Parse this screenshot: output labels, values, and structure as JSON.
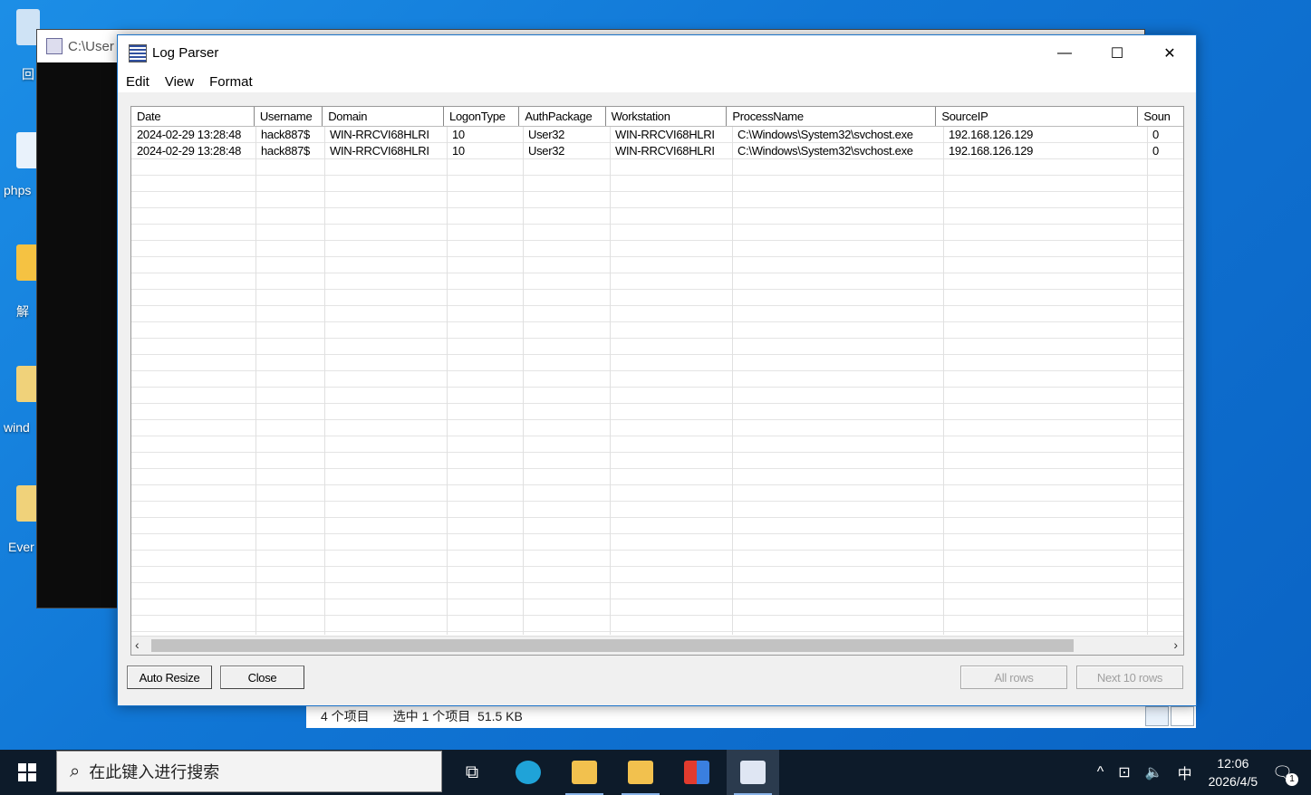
{
  "desktop": {
    "icons": [
      {
        "label": "回",
        "color": "#cfe3f5"
      },
      {
        "label": "phps",
        "color": "#e9f2fb"
      },
      {
        "label": "解",
        "color": "#f5c242"
      },
      {
        "label": "wind",
        "color": "#f0d27a"
      },
      {
        "label": "Ever",
        "color": "#f0d27a"
      }
    ]
  },
  "console": {
    "title": "C:\\User"
  },
  "explorer_status": {
    "items_count": "4 个项目",
    "selected": "选中 1 个项目  51.5 KB"
  },
  "window": {
    "title": "Log Parser",
    "controls": {
      "minimize": "—",
      "maximize": "☐",
      "close": "✕"
    },
    "menu": [
      "Edit",
      "View",
      "Format"
    ]
  },
  "grid": {
    "columns": [
      "Date",
      "Username",
      "Domain",
      "LogonType",
      "AuthPackage",
      "Workstation",
      "ProcessName",
      "SourceIP",
      "Soun"
    ],
    "rows": [
      [
        "2024-02-29 13:28:48",
        "hack887$",
        "WIN-RRCVI68HLRI",
        "10",
        "User32",
        "WIN-RRCVI68HLRI",
        "C:\\Windows\\System32\\svchost.exe",
        "192.168.126.129",
        "0"
      ],
      [
        "2024-02-29 13:28:48",
        "hack887$",
        "WIN-RRCVI68HLRI",
        "10",
        "User32",
        "WIN-RRCVI68HLRI",
        "C:\\Windows\\System32\\svchost.exe",
        "192.168.126.129",
        "0"
      ]
    ]
  },
  "scrollbar": {
    "left_arrow": "‹",
    "right_arrow": "›"
  },
  "buttons": {
    "auto_resize": "Auto Resize",
    "close": "Close",
    "all_rows": "All rows",
    "next_rows": "Next 10 rows"
  },
  "taskbar": {
    "search_placeholder": "在此键入进行搜索",
    "apps": [
      {
        "name": "task-view",
        "color": "#0d1b2a"
      },
      {
        "name": "edge",
        "color": "#1fa3d8"
      },
      {
        "name": "file-explorer",
        "color": "#f2c14e"
      },
      {
        "name": "powershell-folder",
        "color": "#f2c14e"
      },
      {
        "name": "colorful-app",
        "color": "#e23b2e"
      },
      {
        "name": "log-parser",
        "color": "#dfe6f3"
      }
    ],
    "tray": {
      "chevron": "^",
      "network": "⊡",
      "volume": "🔈",
      "ime": "中"
    },
    "clock": {
      "time": "12:06",
      "date": "2026/4/5"
    },
    "notifications": {
      "icon": "🗨",
      "count": "1"
    }
  }
}
